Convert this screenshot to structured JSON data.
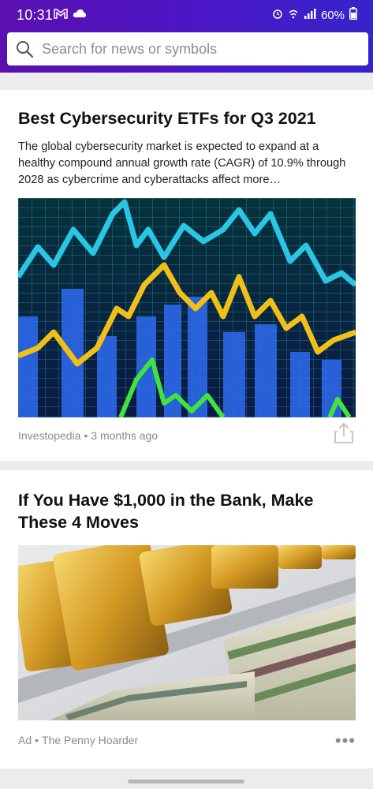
{
  "status_bar": {
    "time": "10:31",
    "battery": "60%",
    "icons": [
      "cloud-icon",
      "gmail-icon",
      "alarm-icon",
      "wifi-icon",
      "signal-icon",
      "battery-icon"
    ]
  },
  "search": {
    "placeholder": "Search for news or symbols"
  },
  "colors": {
    "header_start": "#5b0fb0",
    "header_end": "#3425c9",
    "meta_text": "#8a8a8e"
  },
  "feed": [
    {
      "title": "Best Cybersecurity ETFs for Q3 2021",
      "summary": "The global cybersecurity market is expected to expand at a healthy compound annual growth rate (CAGR) of 10.9% through 2028 as cybercrime and cyberattacks affect more…",
      "source": "Investopedia",
      "separator": "•",
      "time": "3 months ago",
      "action_icon": "share-icon"
    },
    {
      "title": "If You Have $1,000 in the Bank, Make These 4 Moves",
      "ad_label": "Ad",
      "separator": "•",
      "source": "The Penny Hoarder",
      "action_icon": "more-options-icon",
      "more_glyph": "•••"
    }
  ]
}
